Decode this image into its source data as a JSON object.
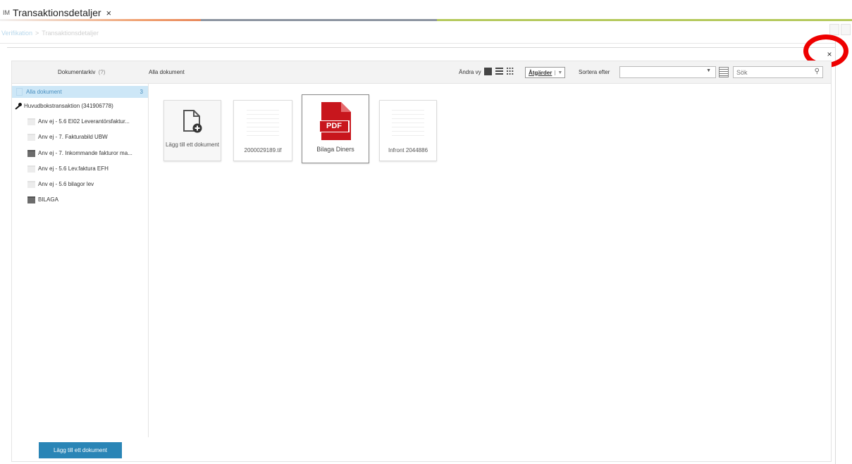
{
  "tab": {
    "prefix": "IM",
    "title": "Transaktionsdetaljer",
    "close": "×"
  },
  "breadcrumb": {
    "parent": "Verifikation",
    "separator": ">",
    "current": "Transaktionsdetaljer"
  },
  "dialog": {
    "close": "×"
  },
  "toolbar": {
    "archive_label": "Dokumentarkiv",
    "archive_help": "(?)",
    "all_docs_title": "Alla dokument",
    "change_view": "Ändra vy",
    "actions": "Åtgärder",
    "sort_by": "Sortera efter",
    "sort_value": "",
    "search_placeholder": "Sök"
  },
  "sidebar": {
    "items": [
      {
        "label": "Alla dokument",
        "count": "3",
        "icon": "document-icon"
      },
      {
        "label": "Huvudbokstransaktion (341906778)",
        "icon": "key-icon"
      },
      {
        "label": "Anv ej - 5.6 EI02 Leverantörsfaktur...",
        "icon": "folder-icon"
      },
      {
        "label": "Anv ej - 7. Fakturabild UBW",
        "icon": "folder-icon"
      },
      {
        "label": "Anv ej - 7. Inkommande fakturor ma...",
        "icon": "folder-icon"
      },
      {
        "label": "Anv ej - 5.6 Lev.faktura EFH",
        "icon": "folder-icon"
      },
      {
        "label": "Anv ej - 5.6 bilagor lev",
        "icon": "folder-icon"
      },
      {
        "label": "BILAGA",
        "icon": "folder-icon"
      }
    ],
    "add_button": "Lägg till ett dokument"
  },
  "tiles": {
    "add": "Lägg till ett dokument",
    "doc1": "2000029189.tif",
    "doc2": "Bilaga Diners",
    "doc2_badge": "PDF",
    "doc3": "Infront 2044886"
  },
  "colors": {
    "accent_blue": "#2a85b6",
    "pdf_red": "#c8161d",
    "highlight": "#ee0000"
  }
}
